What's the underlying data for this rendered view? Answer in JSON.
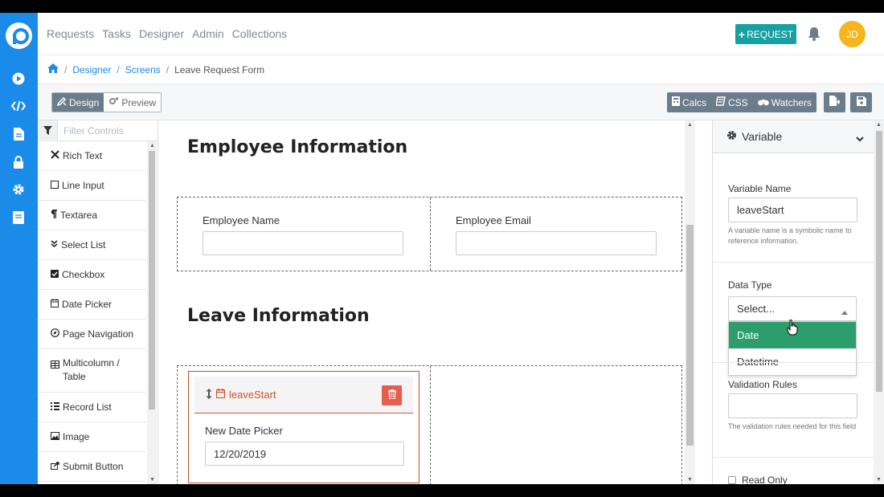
{
  "nav": {
    "links": [
      "Requests",
      "Tasks",
      "Designer",
      "Admin",
      "Collections"
    ],
    "request_button": "REQUEST",
    "request_plus": "+",
    "avatar_initials": "JD"
  },
  "breadcrumb": {
    "designer": "Designer",
    "screens": "Screens",
    "current": "Leave Request Form",
    "sep": "/"
  },
  "toolbar": {
    "design_label": "Design",
    "preview_label": "Preview",
    "calcs_label": "Calcs",
    "css_label": "CSS",
    "watchers_label": "Watchers"
  },
  "controls": {
    "filter_placeholder": "Filter Controls",
    "items": [
      {
        "label": "Rich Text",
        "icon": "tools-icon"
      },
      {
        "label": "Line Input",
        "icon": "square-icon"
      },
      {
        "label": "Textarea",
        "icon": "paragraph-icon"
      },
      {
        "label": "Select List",
        "icon": "double-chevron-icon"
      },
      {
        "label": "Checkbox",
        "icon": "checkbox-icon"
      },
      {
        "label": "Date Picker",
        "icon": "calendar-icon"
      },
      {
        "label": "Page Navigation",
        "icon": "compass-icon"
      },
      {
        "label": "Multicolumn / Table",
        "icon": "table-icon"
      },
      {
        "label": "Record List",
        "icon": "list-icon"
      },
      {
        "label": "Image",
        "icon": "image-icon"
      },
      {
        "label": "Submit Button",
        "icon": "share-icon"
      }
    ]
  },
  "canvas": {
    "section1_title": "Employee Information",
    "employee_name_label": "Employee Name",
    "employee_email_label": "Employee Email",
    "section2_title": "Leave Information",
    "selected_control_name": "leaveStart",
    "date_picker_label": "New Date Picker",
    "date_value": "12/20/2019"
  },
  "inspector": {
    "title": "Variable",
    "variable_name_label": "Variable Name",
    "variable_name_value": "leaveStart",
    "variable_help": "A variable name is a symbolic name to reference information.",
    "data_type_label": "Data Type",
    "data_type_value": "Select...",
    "data_type_options": [
      "Date",
      "Datetime"
    ],
    "validation_label": "Validation Rules",
    "validation_help": "The validation rules needed for this field",
    "read_only_label": "Read Only"
  },
  "colors": {
    "brand_blue": "#1a8be8",
    "request_teal": "#17a0a0",
    "avatar_yellow": "#f6b51d",
    "selected_orange": "#d0502a",
    "option_green": "#2d9e6b"
  }
}
